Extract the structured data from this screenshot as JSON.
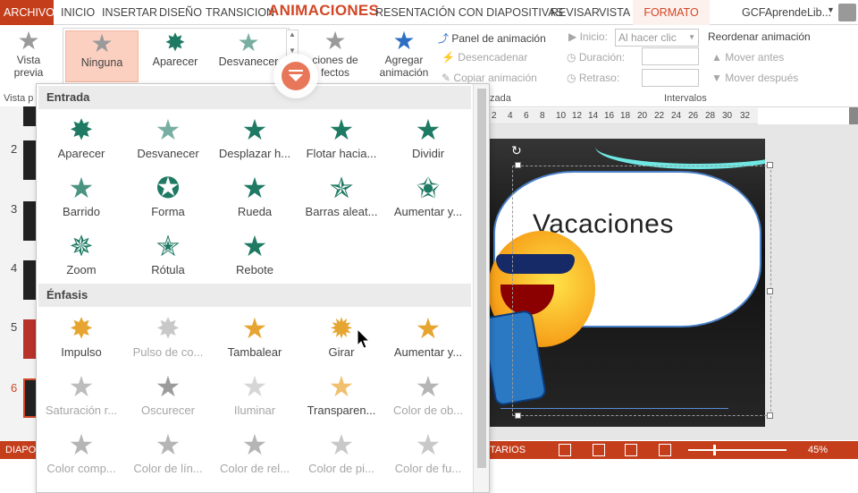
{
  "tabs": {
    "file": "ARCHIVO",
    "home": "INICIO",
    "insert": "INSERTAR",
    "design": "DISEÑO",
    "transitions": "TRANSICION",
    "animations": "ANIMACIONES",
    "slideshow": "RESENTACIÓN CON DIAPOSITIVAS",
    "review": "REVISAR",
    "view": "VISTA",
    "format": "FORMATO",
    "user": "GCFAprendeLib..."
  },
  "ribbon": {
    "preview_label": "Vista",
    "preview_sub": "previa",
    "preview_group": "Vista p",
    "gallery": [
      {
        "label": "Ninguna",
        "icon": "star-gray",
        "selected": true
      },
      {
        "label": "Aparecer",
        "icon": "star-green"
      },
      {
        "label": "Desvanecer",
        "icon": "star-green"
      }
    ],
    "effect_options_1": "ciones de",
    "effect_options_2": "fectos",
    "add_animation_1": "Agregar",
    "add_animation_2": "animación",
    "animation_pane": "Panel de animación",
    "trigger": "Desencadenar",
    "copy_animation": "Copiar animación",
    "group_advanced": "zada",
    "start_label": "Inicio:",
    "start_value": "Al hacer clic",
    "duration_label": "Duración:",
    "delay_label": "Retraso:",
    "group_timing": "Intervalos",
    "reorder": "Reordenar animación",
    "move_earlier": "Mover antes",
    "move_later": "Mover después"
  },
  "ruler": {
    "ticks": [
      "2",
      "4",
      "6",
      "8",
      "10",
      "12",
      "14",
      "16",
      "18",
      "20",
      "22",
      "24",
      "26",
      "28",
      "30",
      "32"
    ]
  },
  "thumbs": {
    "numbers": [
      "2",
      "3",
      "4",
      "5",
      "6"
    ]
  },
  "slide": {
    "title": "Vacaciones"
  },
  "status": {
    "left": "DIAPO",
    "notes": "NTARIOS",
    "zoom": "45%"
  },
  "dropdown": {
    "entrada_title": "Entrada",
    "enfasis_title": "Énfasis",
    "entrada": [
      {
        "label": "Aparecer",
        "icon": "star-burst-green"
      },
      {
        "label": "Desvanecer",
        "icon": "star-fade-green"
      },
      {
        "label": "Desplazar h...",
        "icon": "star-arrow-green"
      },
      {
        "label": "Flotar hacia...",
        "icon": "star-up-green"
      },
      {
        "label": "Dividir",
        "icon": "star-split-green"
      },
      {
        "label": "Barrido",
        "icon": "star-wipe-green"
      },
      {
        "label": "Forma",
        "icon": "star-shape-green"
      },
      {
        "label": "Rueda",
        "icon": "star-wheel-green"
      },
      {
        "label": "Barras aleat...",
        "icon": "star-bars-green"
      },
      {
        "label": "Aumentar y...",
        "icon": "star-grow-green"
      },
      {
        "label": "Zoom",
        "icon": "star-zoom-green"
      },
      {
        "label": "Rótula",
        "icon": "star-swivel-green"
      },
      {
        "label": "Rebote",
        "icon": "star-bounce-green"
      }
    ],
    "enfasis": [
      {
        "label": "Impulso",
        "icon": "star-pulse-gold",
        "disabled": false
      },
      {
        "label": "Pulso de co...",
        "icon": "star-color-pulse-gray",
        "disabled": true
      },
      {
        "label": "Tambalear",
        "icon": "star-teeter-gold",
        "disabled": false
      },
      {
        "label": "Girar",
        "icon": "star-spin-gold",
        "disabled": false
      },
      {
        "label": "Aumentar y...",
        "icon": "star-grow-gold",
        "disabled": false
      },
      {
        "label": "Saturación r...",
        "icon": "star-desaturate-gray",
        "disabled": true
      },
      {
        "label": "Oscurecer",
        "icon": "star-darken-gray",
        "disabled": true
      },
      {
        "label": "Iluminar",
        "icon": "star-lighten-gray",
        "disabled": true
      },
      {
        "label": "Transparen...",
        "icon": "star-transparency-gold",
        "disabled": false
      },
      {
        "label": "Color de ob...",
        "icon": "star-object-color-gray",
        "disabled": true
      },
      {
        "label": "Color comp...",
        "icon": "star-complementary-gray",
        "disabled": true
      },
      {
        "label": "Color de lín...",
        "icon": "star-line-color-gray",
        "disabled": true
      },
      {
        "label": "Color de rel...",
        "icon": "star-fill-color-gray",
        "disabled": true
      },
      {
        "label": "Color de pi...",
        "icon": "star-brush-color-gray",
        "disabled": true
      },
      {
        "label": "Color de fu...",
        "icon": "star-font-color-gray",
        "disabled": true
      }
    ]
  },
  "colors": {
    "accent": "#D24726",
    "file_tab": "#C43E1C",
    "green_star": "#1F7A63",
    "gold_star": "#E6A530"
  }
}
